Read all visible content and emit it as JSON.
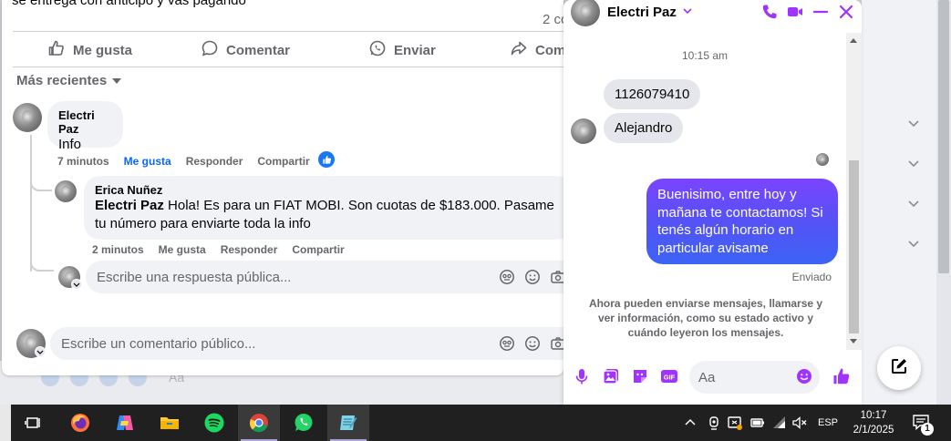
{
  "post": {
    "snippet": "se entrega con anticipo y vas pagando",
    "comment_count": "2 co",
    "actions": {
      "like": "Me gusta",
      "comment": "Comentar",
      "send": "Enviar",
      "share": "Com"
    },
    "sort_label": "Más recientes"
  },
  "comments": [
    {
      "author": "Electri Paz",
      "text": "Info",
      "time": "7 minutos",
      "like_label": "Me gusta",
      "reply_label": "Responder",
      "share_label": "Compartir"
    },
    {
      "author": "Erica Nuñez",
      "mention": "Electri Paz",
      "text": "Hola! Es para un FIAT MOBI. Son cuotas de $183.000. Pasame tu número para enviarte toda la info",
      "time": "2 minutos",
      "like_label": "Me gusta",
      "reply_label": "Responder",
      "share_label": "Compartir"
    }
  ],
  "reply_input": {
    "placeholder": "Escribe una respuesta pública..."
  },
  "comment_input": {
    "placeholder": "Escribe un comentario público..."
  },
  "background_composer": {
    "placeholder": "Aa"
  },
  "chat": {
    "contact_name": "Electri Paz",
    "timestamp": "10:15 am",
    "incoming": [
      "1126079410",
      "Alejandro"
    ],
    "outgoing": "Buenisimo, entre hoy y mañana te contactamos! Si tenés algún horario en particular avisame",
    "status": "Enviado",
    "notice": "Ahora pueden enviarse mensajes, llamarse y ver información, como su estado activo y cuándo leyeron los mensajes.",
    "input_placeholder": "Aa",
    "accent_color": "#a033ff"
  },
  "taskbar": {
    "apps": [
      "task-view-icon",
      "firefox-icon",
      "copilot-icon",
      "file-explorer-icon",
      "spotify-icon",
      "chrome-icon",
      "whatsapp-icon",
      "notepad-icon"
    ],
    "language": "ESP",
    "time": "10:17",
    "date": "2/1/2025",
    "notification_count": "1"
  }
}
